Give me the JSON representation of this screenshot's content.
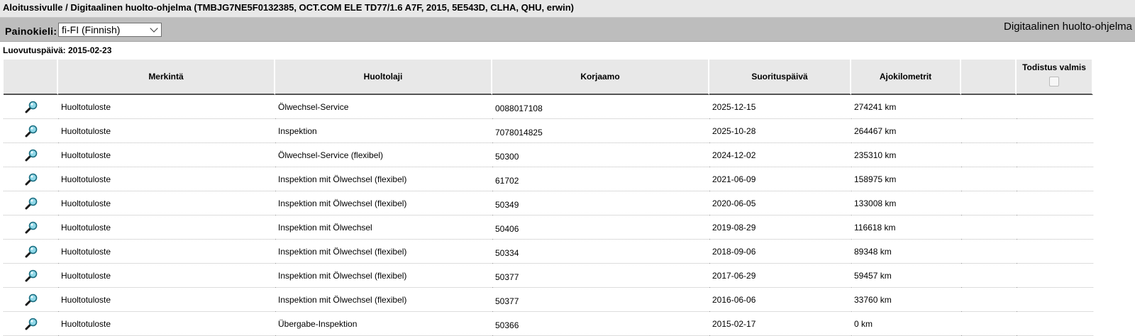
{
  "breadcrumb": "Aloitussivulle / Digitaalinen huolto-ohjelma (TMBJG7NE5F0132385, OCT.COM ELE TD77/1.6 A7F, 2015, 5E543D, CLHA, QHU, erwin)",
  "language": {
    "label": "Painokieli:",
    "selected": "fi-FI (Finnish)"
  },
  "app_title": "Digitaalinen huolto-ohjelma",
  "delivery_date": "Luovutuspäivä: 2015-02-23",
  "table": {
    "headers": {
      "marking": "Merkintä",
      "service_type": "Huoltolaji",
      "workshop": "Korjaamo",
      "date": "Suorituspäivä",
      "mileage": "Ajokilometrit",
      "certificate": "Todistus valmis"
    },
    "rows": [
      {
        "marking": "Huoltotuloste",
        "service_type": "Ölwechsel-Service",
        "workshop": "0088017108",
        "date": "2025-12-15",
        "mileage": "274241 km"
      },
      {
        "marking": "Huoltotuloste",
        "service_type": "Inspektion",
        "workshop": "7078014825",
        "date": "2025-10-28",
        "mileage": "264467 km"
      },
      {
        "marking": "Huoltotuloste",
        "service_type": "Ölwechsel-Service (flexibel)",
        "workshop": "50300",
        "date": "2024-12-02",
        "mileage": "235310 km"
      },
      {
        "marking": "Huoltotuloste",
        "service_type": "Inspektion mit Ölwechsel (flexibel)",
        "workshop": "61702",
        "date": "2021-06-09",
        "mileage": "158975 km"
      },
      {
        "marking": "Huoltotuloste",
        "service_type": "Inspektion mit Ölwechsel (flexibel)",
        "workshop": "50349",
        "date": "2020-06-05",
        "mileage": "133008 km"
      },
      {
        "marking": "Huoltotuloste",
        "service_type": "Inspektion mit Ölwechsel",
        "workshop": "50406",
        "date": "2019-08-29",
        "mileage": "116618 km"
      },
      {
        "marking": "Huoltotuloste",
        "service_type": "Inspektion mit Ölwechsel (flexibel)",
        "workshop": "50334",
        "date": "2018-09-06",
        "mileage": "89348 km"
      },
      {
        "marking": "Huoltotuloste",
        "service_type": "Inspektion mit Ölwechsel (flexibel)",
        "workshop": "50377",
        "date": "2017-06-29",
        "mileage": "59457 km"
      },
      {
        "marking": "Huoltotuloste",
        "service_type": "Inspektion mit Ölwechsel (flexibel)",
        "workshop": "50377",
        "date": "2016-06-06",
        "mileage": "33760 km"
      },
      {
        "marking": "Huoltotuloste",
        "service_type": "Übergabe-Inspektion",
        "workshop": "50366",
        "date": "2015-02-17",
        "mileage": "0 km"
      }
    ]
  },
  "icons": {
    "row_view": "magnifier-icon",
    "dropdown": "chevron-down-icon"
  },
  "colors": {
    "header_bar": "#bdbdbd",
    "breadcrumb_bar": "#e8e8e8",
    "table_header": "#e8e8e8",
    "magnifier_lens": "#3ab0c8"
  }
}
